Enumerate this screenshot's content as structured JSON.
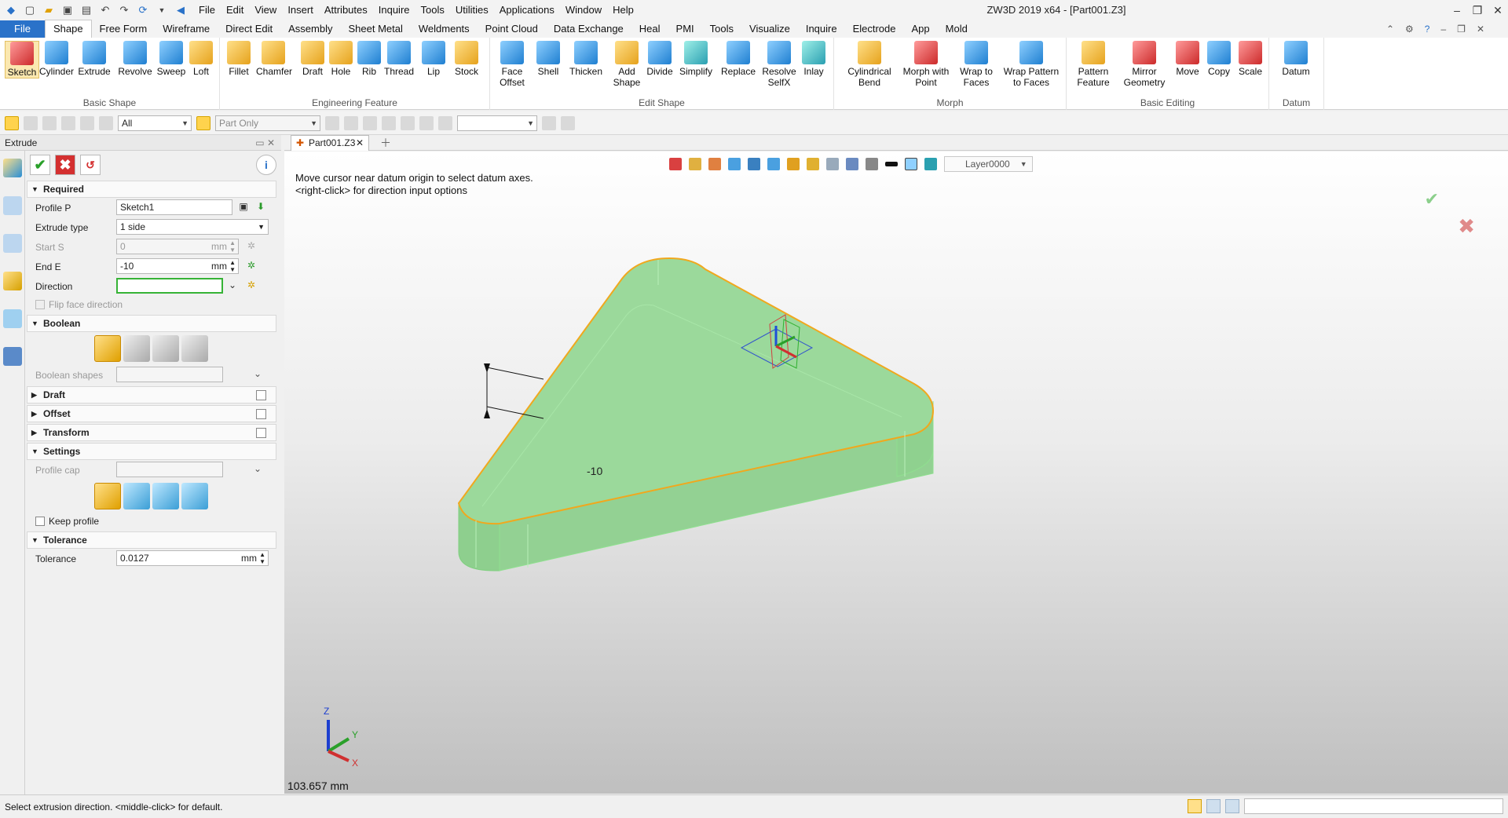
{
  "window": {
    "title": "ZW3D 2019  x64 - [Part001.Z3]"
  },
  "menu": [
    "File",
    "Edit",
    "View",
    "Insert",
    "Attributes",
    "Inquire",
    "Tools",
    "Utilities",
    "Applications",
    "Window",
    "Help"
  ],
  "ribbon_tabs": [
    "File",
    "Shape",
    "Free Form",
    "Wireframe",
    "Direct Edit",
    "Assembly",
    "Sheet Metal",
    "Weldments",
    "Point Cloud",
    "Data Exchange",
    "Heal",
    "PMI",
    "Tools",
    "Visualize",
    "Inquire",
    "Electrode",
    "App",
    "Mold"
  ],
  "ribbon_groups": {
    "basic_shape": {
      "name": "Basic Shape",
      "buttons": [
        "Sketch",
        "Cylinder",
        "Extrude",
        "Revolve",
        "Sweep",
        "Loft"
      ]
    },
    "engineering": {
      "name": "Engineering Feature",
      "buttons": [
        "Fillet",
        "Chamfer",
        "Draft",
        "Hole",
        "Rib",
        "Thread",
        "Lip",
        "Stock"
      ]
    },
    "edit_shape": {
      "name": "Edit Shape",
      "buttons": [
        "Face Offset",
        "Shell",
        "Thicken",
        "Add Shape",
        "Divide",
        "Simplify",
        "Replace",
        "Resolve SelfX",
        "Inlay"
      ]
    },
    "morph": {
      "name": "Morph",
      "buttons": [
        "Cylindrical Bend",
        "Morph with Point",
        "Wrap to Faces",
        "Wrap Pattern to Faces"
      ]
    },
    "basic_editing": {
      "name": "Basic Editing",
      "buttons": [
        "Pattern Feature",
        "Mirror Geometry",
        "Move",
        "Copy",
        "Scale"
      ]
    },
    "datum": {
      "name": "Datum",
      "buttons": [
        "Datum"
      ]
    }
  },
  "toolbar": {
    "filter": "All",
    "scope": "Part Only",
    "empty_combo": ""
  },
  "panel": {
    "title": "Extrude",
    "required": {
      "header": "Required",
      "profile_label": "Profile P",
      "profile_value": "Sketch1",
      "type_label": "Extrude type",
      "type_value": "1 side",
      "start_label": "Start S",
      "start_value": "0",
      "start_unit": "mm",
      "end_label": "End E",
      "end_value": "-10",
      "end_unit": "mm",
      "direction_label": "Direction",
      "direction_value": "",
      "flip_label": "Flip face direction"
    },
    "boolean": {
      "header": "Boolean",
      "shapes_label": "Boolean shapes"
    },
    "draft": {
      "header": "Draft"
    },
    "offset": {
      "header": "Offset"
    },
    "transform": {
      "header": "Transform"
    },
    "settings": {
      "header": "Settings",
      "cap_label": "Profile cap",
      "keep_label": "Keep profile"
    },
    "tolerance": {
      "header": "Tolerance",
      "label": "Tolerance",
      "value": "0.0127",
      "unit": "mm"
    }
  },
  "doc_tab": {
    "label": "Part001.Z3"
  },
  "viewport": {
    "prompt_line1": "Move cursor near datum origin to select datum axes.",
    "prompt_line2": "<right-click> for direction input options",
    "layer": "Layer0000",
    "dimension": "-10",
    "scale": "103.657 mm",
    "triad": {
      "x": "X",
      "y": "Y",
      "z": "Z"
    }
  },
  "status": {
    "text": "Select extrusion direction.  <middle-click> for default."
  }
}
